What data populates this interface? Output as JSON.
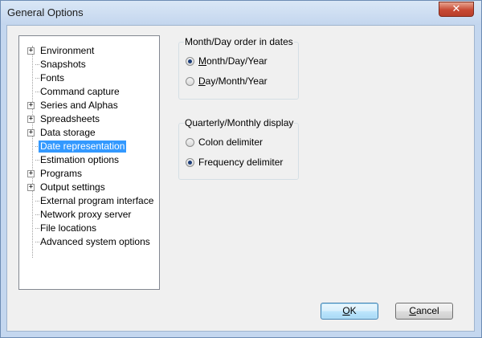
{
  "window": {
    "title": "General Options",
    "close_glyph": "✕"
  },
  "tree": {
    "items": [
      {
        "label": "Environment",
        "expandable": true
      },
      {
        "label": "Snapshots",
        "expandable": false
      },
      {
        "label": "Fonts",
        "expandable": false
      },
      {
        "label": "Command capture",
        "expandable": false
      },
      {
        "label": "Series and Alphas",
        "expandable": true
      },
      {
        "label": "Spreadsheets",
        "expandable": true
      },
      {
        "label": "Data storage",
        "expandable": true
      },
      {
        "label": "Date representation",
        "expandable": false,
        "selected": true
      },
      {
        "label": "Estimation options",
        "expandable": false
      },
      {
        "label": "Programs",
        "expandable": true
      },
      {
        "label": "Output settings",
        "expandable": true
      },
      {
        "label": "External program interface",
        "expandable": false
      },
      {
        "label": "Network proxy server",
        "expandable": false
      },
      {
        "label": "File locations",
        "expandable": false
      },
      {
        "label": "Advanced system options",
        "expandable": false
      }
    ]
  },
  "date_order": {
    "title": "Month/Day order in dates",
    "options": [
      {
        "accel": "M",
        "rest": "onth/Day/Year",
        "checked": true
      },
      {
        "accel": "D",
        "rest": "ay/Month/Year",
        "checked": false
      }
    ]
  },
  "display": {
    "title": "Quarterly/Monthly display",
    "options": [
      {
        "label": "Colon delimiter",
        "checked": false
      },
      {
        "label": "Frequency delimiter",
        "checked": true
      }
    ]
  },
  "buttons": {
    "ok_accel": "O",
    "ok_rest": "K",
    "cancel_accel": "C",
    "cancel_rest": "ancel"
  },
  "colors": {
    "selection": "#3399ff",
    "title_bar": "#c4d7ef",
    "close_button": "#c74a34"
  }
}
